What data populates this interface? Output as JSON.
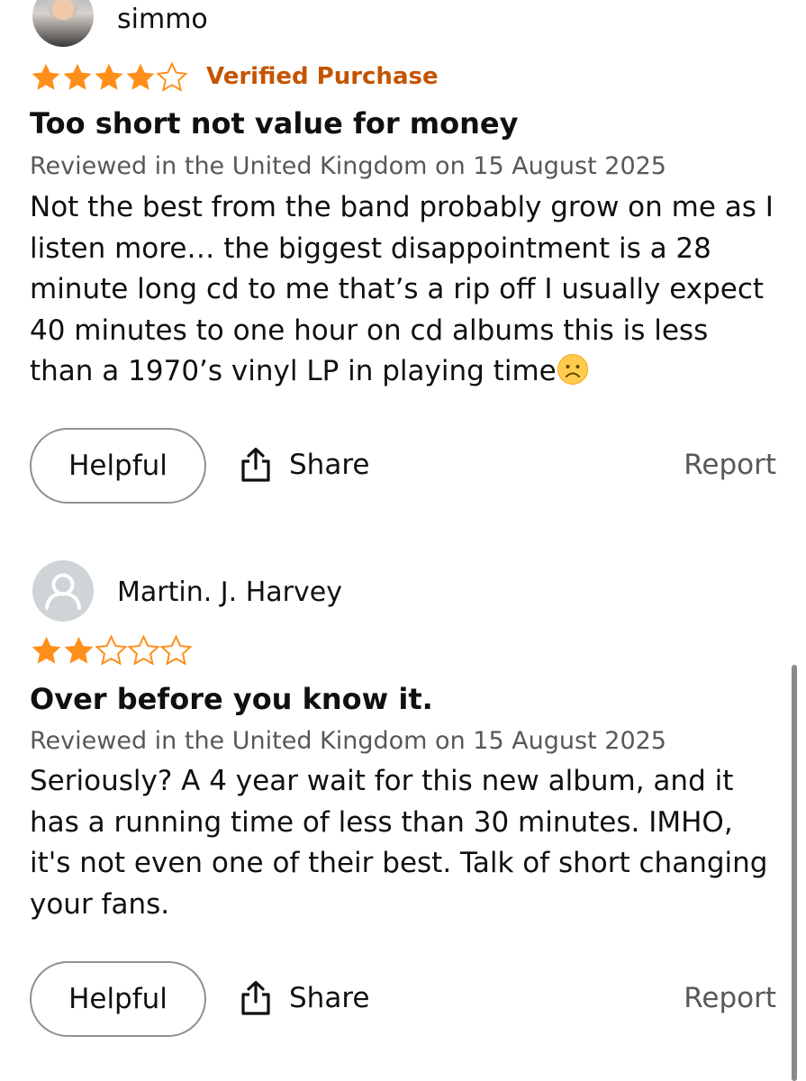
{
  "reviews": [
    {
      "reviewer": "simmo",
      "avatar": "user-photo",
      "rating": 4,
      "rating_max": 5,
      "badge": "Verified Purchase",
      "title": "Too short not value for money",
      "meta": "Reviewed in the United Kingdom on 15 August 2025",
      "body": "Not the best from the band probably grow on me as I listen more… the biggest disappointment is a 28 minute long cd to me that’s a rip off I usually expect 40 minutes to one hour on cd albums this is less than a 1970’s vinyl LP in playing time",
      "body_emoji": "frowning-face-icon",
      "actions": {
        "helpful": "Helpful",
        "share": "Share",
        "report": "Report"
      }
    },
    {
      "reviewer": "Martin. J. Harvey",
      "avatar": "default-user-icon",
      "rating": 2,
      "rating_max": 5,
      "badge": "",
      "title": "Over before you know it.",
      "meta": "Reviewed in the United Kingdom on 15 August 2025",
      "body": "Seriously? A 4 year wait for this new album, and it has a running time of less than 30 minutes. IMHO, it's not even one of their best. Talk of short changing your fans.",
      "actions": {
        "helpful": "Helpful",
        "share": "Share",
        "report": "Report"
      }
    }
  ],
  "colors": {
    "star": "#ff8f1a",
    "badge": "#c45500",
    "meta": "#565959",
    "text": "#0f1111"
  }
}
